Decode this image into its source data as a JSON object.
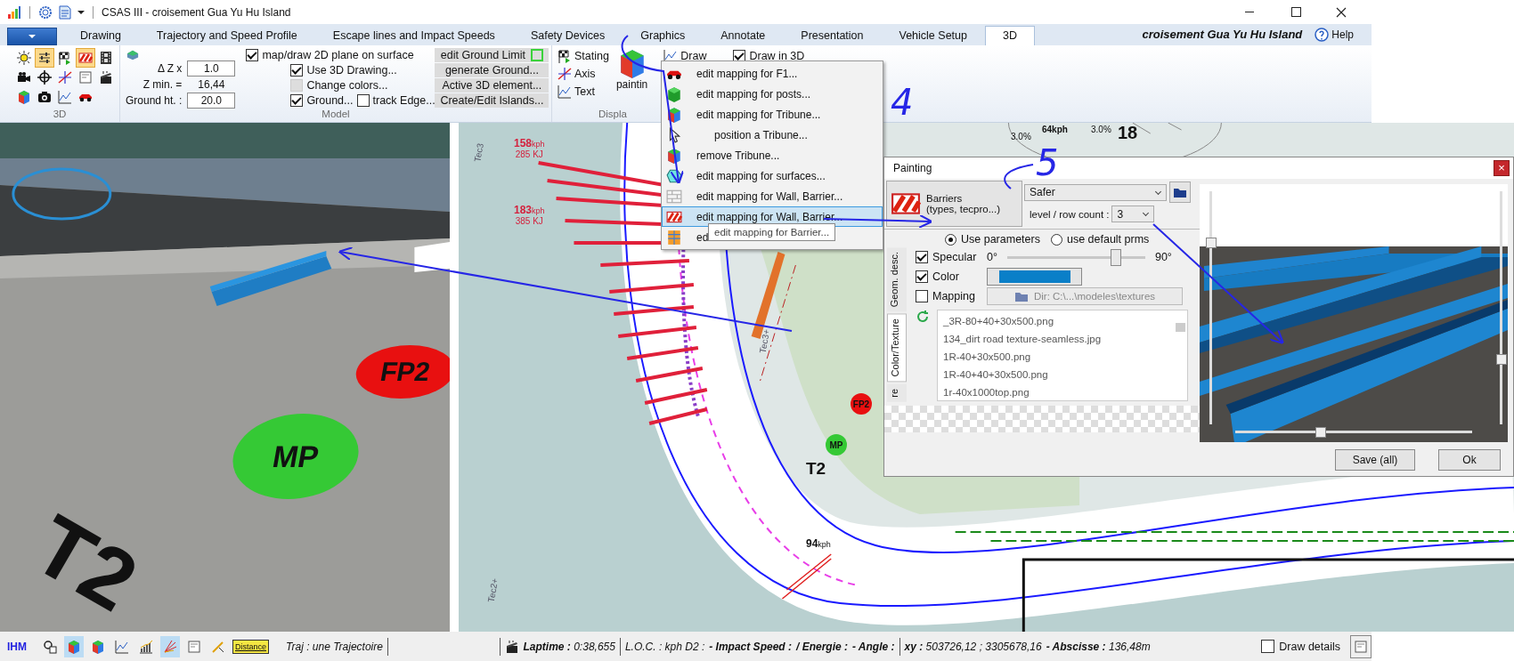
{
  "title_bar": {
    "title": "CSAS III - croisement Gua Yu Hu Island"
  },
  "tabs": [
    {
      "label": "Drawing",
      "selected": false
    },
    {
      "label": "Trajectory and Speed Profile",
      "selected": false
    },
    {
      "label": "Escape lines and Impact Speeds",
      "selected": false
    },
    {
      "label": "Safety Devices",
      "selected": false
    },
    {
      "label": "Graphics",
      "selected": false
    },
    {
      "label": "Annotate",
      "selected": false
    },
    {
      "label": "Presentation",
      "selected": false
    },
    {
      "label": "Vehicle Setup",
      "selected": false
    },
    {
      "label": "3D",
      "selected": true
    }
  ],
  "project_name": "croisement Gua Yu Hu Island",
  "help": "Help",
  "ribbon": {
    "tools_3d": {
      "label": "3D",
      "tools": [
        {
          "kind": "sun",
          "selected": false
        },
        {
          "kind": "sliders",
          "selected": true
        },
        {
          "kind": "flag",
          "selected": false
        },
        {
          "kind": "stripes",
          "selected": true
        },
        {
          "kind": "film",
          "selected": false
        },
        {
          "kind": "camera",
          "selected": false
        },
        {
          "kind": "crosshair",
          "selected": false
        },
        {
          "kind": "axes",
          "selected": false
        },
        {
          "kind": "frame",
          "selected": false
        },
        {
          "kind": "clapper",
          "selected": false
        },
        {
          "kind": "cube",
          "selected": false
        },
        {
          "kind": "photo",
          "selected": false
        },
        {
          "kind": "graph",
          "selected": false
        },
        {
          "kind": "car",
          "selected": false
        }
      ]
    },
    "model": {
      "label": "Model",
      "fields": [
        {
          "label": "Δ Z x",
          "value": "1.0",
          "editable": true
        },
        {
          "label": "Z min. =",
          "value": "16,44",
          "editable": false
        },
        {
          "label": "Ground ht. :",
          "value": "20.0",
          "editable": true
        }
      ],
      "checks": [
        {
          "label": "map/draw 2D plane on surface",
          "checked": true,
          "disabled": false
        },
        {
          "label": "Use 3D Drawing...",
          "checked": true,
          "disabled": false
        },
        {
          "label": "Change colors...",
          "checked": false,
          "disabled": true
        },
        {
          "label": "Ground...",
          "checked": true,
          "disabled": false
        },
        {
          "label": "track Edge...",
          "checked": false,
          "disabled": false
        }
      ],
      "buttons": [
        "edit Ground Limit",
        "generate Ground...",
        "Active 3D element...",
        "Create/Edit Islands..."
      ]
    },
    "display": {
      "label": "Displa",
      "items": [
        {
          "label": "Stating",
          "kind": "flag"
        },
        {
          "label": "Axis",
          "kind": "axes"
        },
        {
          "label": "Text",
          "kind": "graph"
        }
      ],
      "painting": "paintin",
      "draw": "Draw",
      "draw_in_3d": {
        "label": "Draw in 3D",
        "checked": true
      }
    }
  },
  "context_menu": {
    "items": [
      {
        "label": "edit mapping for F1...",
        "kind": "car",
        "indented": false,
        "selected": false
      },
      {
        "label": "edit mapping for posts...",
        "kind": "box",
        "indented": false,
        "selected": false
      },
      {
        "label": "edit mapping for Tribune...",
        "kind": "cube",
        "indented": false,
        "selected": false
      },
      {
        "label": "position a Tribune...",
        "kind": "cursor",
        "indented": true,
        "selected": false
      },
      {
        "label": "remove Tribune...",
        "kind": "cube",
        "indented": false,
        "selected": false
      },
      {
        "label": "edit mapping for surfaces...",
        "kind": "polygon",
        "indented": false,
        "selected": false
      },
      {
        "label": "edit mapping for Wall, Barrier...",
        "kind": "bricks",
        "indented": false,
        "selected": false
      },
      {
        "label": "edit mapping for Wall, Barrier...",
        "kind": "stripes",
        "indented": false,
        "selected": true
      },
      {
        "label": "ed",
        "kind": "grid",
        "indented": false,
        "selected": false
      }
    ],
    "tooltip": "edit mapping for Barrier..."
  },
  "dialog": {
    "title": "Painting",
    "close": "×",
    "object_type": [
      "Barriers",
      "(types, tecpro...)"
    ],
    "model": "Safer",
    "level_label": "level / row count :",
    "level_count": "3",
    "modes": [
      {
        "label": "Use parameters",
        "selected": true
      },
      {
        "label": "use default prms",
        "selected": false
      }
    ],
    "side_tabs": [
      {
        "label": "Geom. desc.",
        "selected": false
      },
      {
        "label": "Color/Texture",
        "selected": true
      },
      {
        "label": "re",
        "selected": false
      }
    ],
    "specular": {
      "label": "Specular",
      "checked": true,
      "min": "0°",
      "max": "90°",
      "level": 0.78
    },
    "color": {
      "label": "Color",
      "checked": true,
      "color": "#0a7fc8"
    },
    "mapping": {
      "label": "Mapping",
      "checked": false,
      "dir": "Dir: C:\\...\\modeles\\textures"
    },
    "files": [
      "_3R-80+40+30x500.png",
      "134_dirt road texture-seamless.jpg",
      "1R-40+30x500.png",
      "1R-40+40+30x500.png",
      "1r-40x1000top.png"
    ],
    "preview_sliders": [
      {
        "kind": "vertical",
        "level": 0.8
      },
      {
        "kind": "vertical",
        "level": 0.3
      },
      {
        "kind": "horizontal",
        "level": 0.36
      }
    ],
    "buttons": [
      "Save (all)",
      "Ok"
    ]
  },
  "map": {
    "speed_labels": [
      {
        "speed": "158",
        "unit": "kph",
        "energy": "285 KJ"
      },
      {
        "speed": "183",
        "unit": "kph",
        "energy": "385 KJ"
      }
    ],
    "track_labels": [
      "Tec3",
      "Tec3+",
      "Tec2+"
    ],
    "markers": [
      {
        "label": "FP2",
        "color": "#e81010"
      },
      {
        "label": "MP",
        "color": "#35c935"
      }
    ],
    "turn": "T2",
    "speed_readout": {
      "speed": "94",
      "unit": "kph"
    },
    "top_labels": [
      "3.0%",
      "64kph",
      "3.0%",
      "18"
    ]
  },
  "view_3d": {
    "markers": [
      {
        "label": "FP2",
        "color": "#e81010"
      },
      {
        "label": "MP",
        "color": "#35c935"
      }
    ],
    "turn": "T2"
  },
  "status_bar": {
    "label": "IHM",
    "tools": [
      {
        "kind": "magnifier",
        "selected": false
      },
      {
        "kind": "cube",
        "selected": true
      },
      {
        "kind": "cube",
        "selected": false
      },
      {
        "kind": "graph",
        "selected": false
      },
      {
        "kind": "bars",
        "selected": false
      },
      {
        "kind": "fan",
        "selected": true
      },
      {
        "kind": "frame",
        "selected": false
      },
      {
        "kind": "pencil",
        "selected": false
      }
    ],
    "distance": "Distance",
    "traj": "Traj :  une Trajectoire",
    "laptime": "**Laptime :** 0:38,655",
    "loc": "L.O.C. : kph  D2 :",
    "impact": "- Impact Speed :",
    "energy": "/ Energie :",
    "angle": "- Angle :",
    "xy": "**xy :** 503726,12 ; 3305678,16",
    "abscisse": "**- Abscisse :** 136,48m",
    "draw_details": {
      "label": "Draw details",
      "checked": false
    }
  },
  "annotations": [
    "4",
    "5"
  ]
}
